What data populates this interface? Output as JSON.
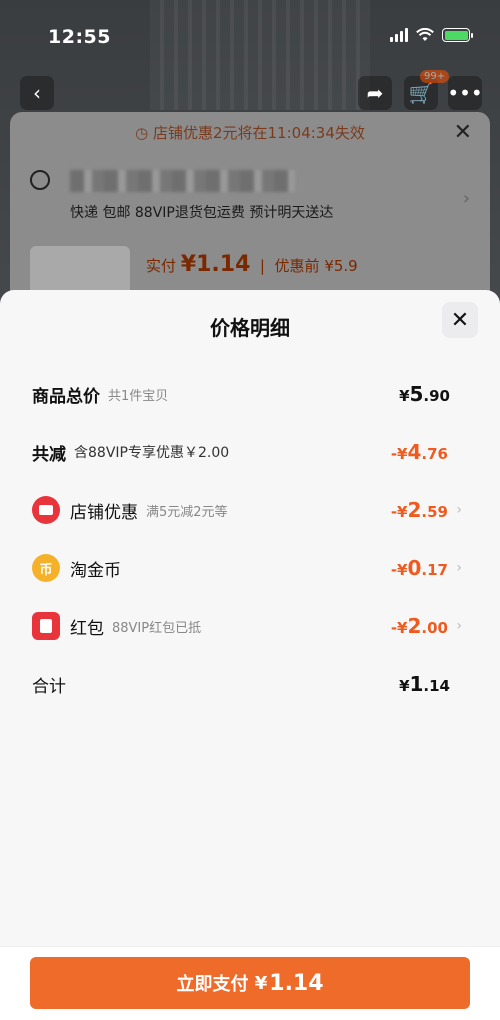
{
  "status_bar": {
    "time": "12:55"
  },
  "background": {
    "cart_badge": "99+",
    "coupon_notice": "店铺优惠2元将在11:04:34失效",
    "delivery": "快递 包邮 88VIP退货包运费 预计明天送达",
    "price_paid_label": "实付",
    "price_paid_value": "¥1.14",
    "price_before_label": "优惠前",
    "price_before_value": "¥5.9"
  },
  "sheet": {
    "title": "价格明细",
    "rows": [
      {
        "label": "商品总价",
        "sub": "共1件宝贝",
        "amount_prefix": "¥",
        "amount_main": "5",
        "amount_dec": ".90"
      },
      {
        "label": "共减",
        "sub": "含88VIP专享优惠￥2.00",
        "amount_prefix": "-¥",
        "amount_main": "4",
        "amount_dec": ".76"
      },
      {
        "label": "店铺优惠",
        "sub": "满5元减2元等",
        "amount_prefix": "-¥",
        "amount_main": "2",
        "amount_dec": ".59"
      },
      {
        "label": "淘金币",
        "sub": "",
        "amount_prefix": "-¥",
        "amount_main": "0",
        "amount_dec": ".17"
      },
      {
        "label": "红包",
        "sub": "88VIP红包已抵",
        "amount_prefix": "-¥",
        "amount_main": "2",
        "amount_dec": ".00"
      },
      {
        "label": "合计",
        "sub": "",
        "amount_prefix": "¥",
        "amount_main": "1",
        "amount_dec": ".14"
      }
    ],
    "coin_glyph": "币"
  },
  "pay_button": {
    "label": "立即支付",
    "prefix": "¥",
    "amount": "1.14"
  },
  "colors": {
    "accent": "#ef6b2a",
    "discount": "#f05a1e",
    "shop_icon": "#e8353b",
    "coin_icon": "#f6b12a"
  },
  "icons": [
    "back-icon",
    "share-icon",
    "cart-icon",
    "more-icon",
    "close-icon",
    "location-icon",
    "shop-coupon-icon",
    "taojinbi-coin-icon",
    "red-packet-icon",
    "chevron-right-icon"
  ]
}
